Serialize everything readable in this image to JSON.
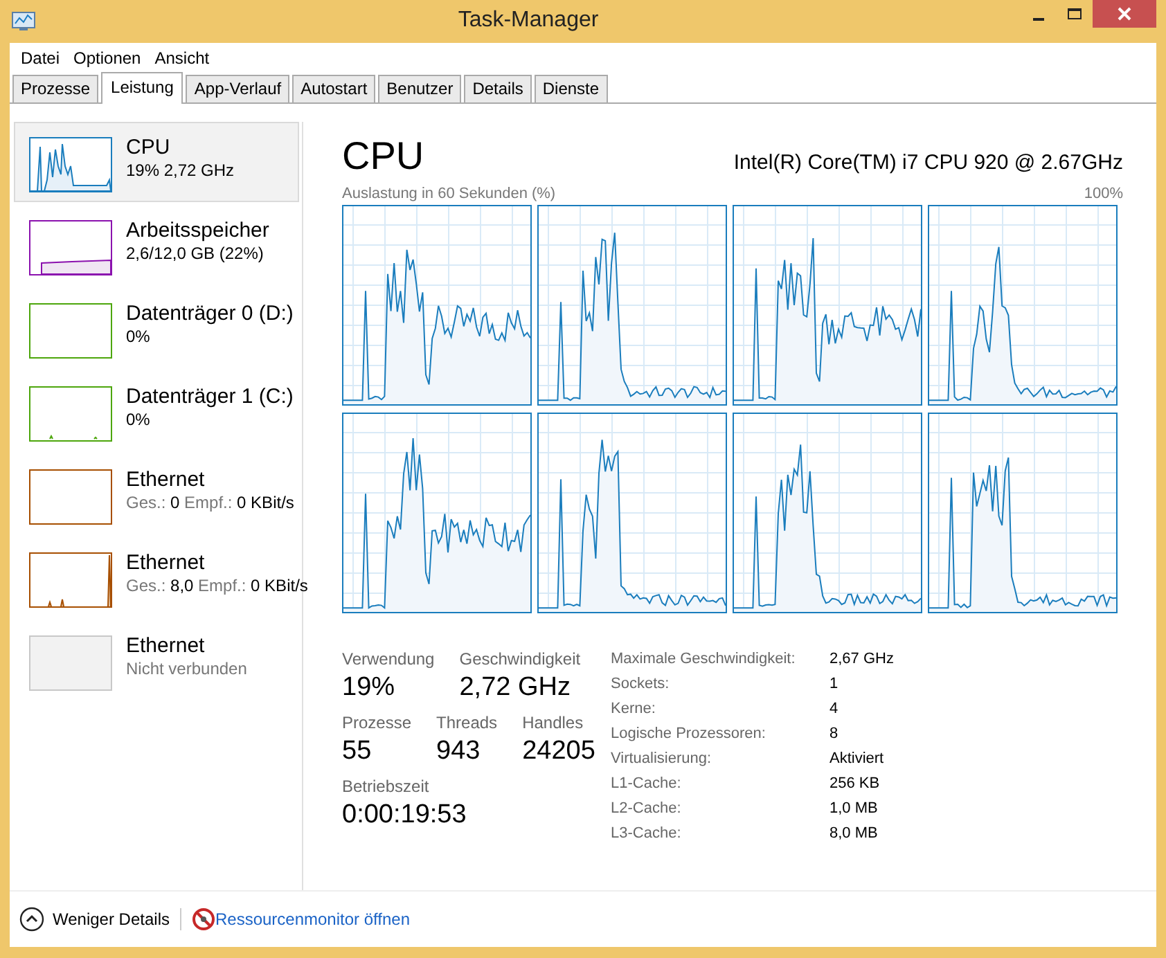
{
  "window": {
    "title": "Task-Manager"
  },
  "menu": [
    "Datei",
    "Optionen",
    "Ansicht"
  ],
  "tabs": [
    {
      "label": "Prozesse",
      "selected": false
    },
    {
      "label": "Leistung",
      "selected": true
    },
    {
      "label": "App-Verlauf",
      "selected": false
    },
    {
      "label": "Autostart",
      "selected": false
    },
    {
      "label": "Benutzer",
      "selected": false
    },
    {
      "label": "Details",
      "selected": false
    },
    {
      "label": "Dienste",
      "selected": false
    }
  ],
  "sidebar": {
    "items": [
      {
        "name": "CPU",
        "kind": "cpu",
        "color": "#1a7dbd",
        "selected": true,
        "detail": "19% 2,72 GHz"
      },
      {
        "name": "Arbeitsspeicher",
        "kind": "memory",
        "color": "#8b12ae",
        "selected": false,
        "detail": "2,6/12,0 GB (22%)"
      },
      {
        "name": "Datenträger 0 (D:)",
        "kind": "disk",
        "color": "#4da60c",
        "selected": false,
        "detail": "0%"
      },
      {
        "name": "Datenträger 1 (C:)",
        "kind": "disk",
        "color": "#4da60c",
        "selected": false,
        "detail": "0%"
      },
      {
        "name": "Ethernet",
        "kind": "network",
        "color": "#a74f01",
        "selected": false,
        "rates": [
          {
            "label": "Ges.:",
            "value": "0"
          },
          {
            "label": "Empf.:",
            "value": "0 KBit/s"
          }
        ]
      },
      {
        "name": "Ethernet",
        "kind": "network",
        "color": "#a74f01",
        "selected": false,
        "rates": [
          {
            "label": "Ges.:",
            "value": "8,0"
          },
          {
            "label": "Empf.:",
            "value": "0 KBit/s"
          }
        ]
      },
      {
        "name": "Ethernet",
        "kind": "disconnected",
        "color": "#c8c8c8",
        "selected": false,
        "detail": "Nicht verbunden"
      }
    ]
  },
  "cpu_panel": {
    "title": "CPU",
    "processor": "Intel(R) Core(TM) i7 CPU 920 @ 2.67GHz",
    "graph_caption": "Auslastung in 60 Sekunden (%)",
    "graph_max": "100%",
    "core_graphs": [
      {
        "kind": "picture"
      },
      {
        "kind": "picture"
      },
      {
        "kind": "picture"
      },
      {
        "kind": "picture"
      },
      {
        "kind": "picture"
      },
      {
        "kind": "picture"
      },
      {
        "kind": "picture"
      },
      {
        "kind": "picture"
      }
    ],
    "stats": [
      [
        {
          "label": "Verwendung",
          "value": "19%"
        },
        {
          "label": "Geschwindigkeit",
          "value": "2,72 GHz"
        }
      ],
      [
        {
          "label": "Prozesse",
          "value": "55"
        },
        {
          "label": "Threads",
          "value": "943"
        },
        {
          "label": "Handles",
          "value": "24205"
        }
      ],
      [
        {
          "label": "Betriebszeit",
          "value": "0:00:19:53"
        }
      ]
    ],
    "details": [
      {
        "label": "Maximale Geschwindigkeit:",
        "value": "2,67 GHz"
      },
      {
        "label": "Sockets:",
        "value": "1"
      },
      {
        "label": "Kerne:",
        "value": "4"
      },
      {
        "label": "Logische Prozessoren:",
        "value": "8"
      },
      {
        "label": "Virtualisierung:",
        "value": "Aktiviert"
      },
      {
        "label": "L1-Cache:",
        "value": "256 KB"
      },
      {
        "label": "L2-Cache:",
        "value": "1,0 MB"
      },
      {
        "label": "L3-Cache:",
        "value": "8,0 MB"
      }
    ]
  },
  "footer": {
    "toggle": "Weniger Details",
    "link": "Ressourcenmonitor öffnen"
  }
}
